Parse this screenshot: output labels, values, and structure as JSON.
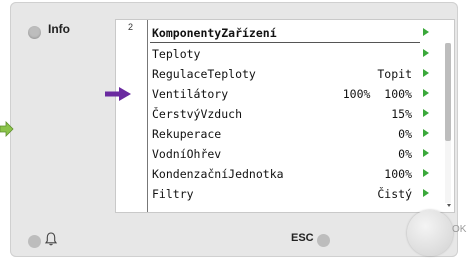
{
  "colors": {
    "panel": "#e7e7e7",
    "row_arrow": "#3aa83a",
    "pointer_arrow": "#6a2aa0",
    "external_arrow": "#8bc34a"
  },
  "left_panel": {
    "info_label": "Info"
  },
  "screen": {
    "page_number": "2",
    "rows": [
      {
        "label": "KomponentyZařízení",
        "value": ""
      },
      {
        "label": "Teploty",
        "value": ""
      },
      {
        "label": "RegulaceTeploty",
        "value": "Topit"
      },
      {
        "label": "Ventilátory",
        "value": "100%  100%"
      },
      {
        "label": "ČerstvýVzduch",
        "value": "15%"
      },
      {
        "label": "Rekuperace",
        "value": "0%"
      },
      {
        "label": "VodníOhřev",
        "value": "0%"
      },
      {
        "label": "KondenzačníJednotka",
        "value": "100%"
      },
      {
        "label": "Filtry",
        "value": "Čistý"
      }
    ]
  },
  "bottom": {
    "esc_label": "ESC",
    "ok_label": "OK",
    "bell_icon": "bell-icon"
  }
}
